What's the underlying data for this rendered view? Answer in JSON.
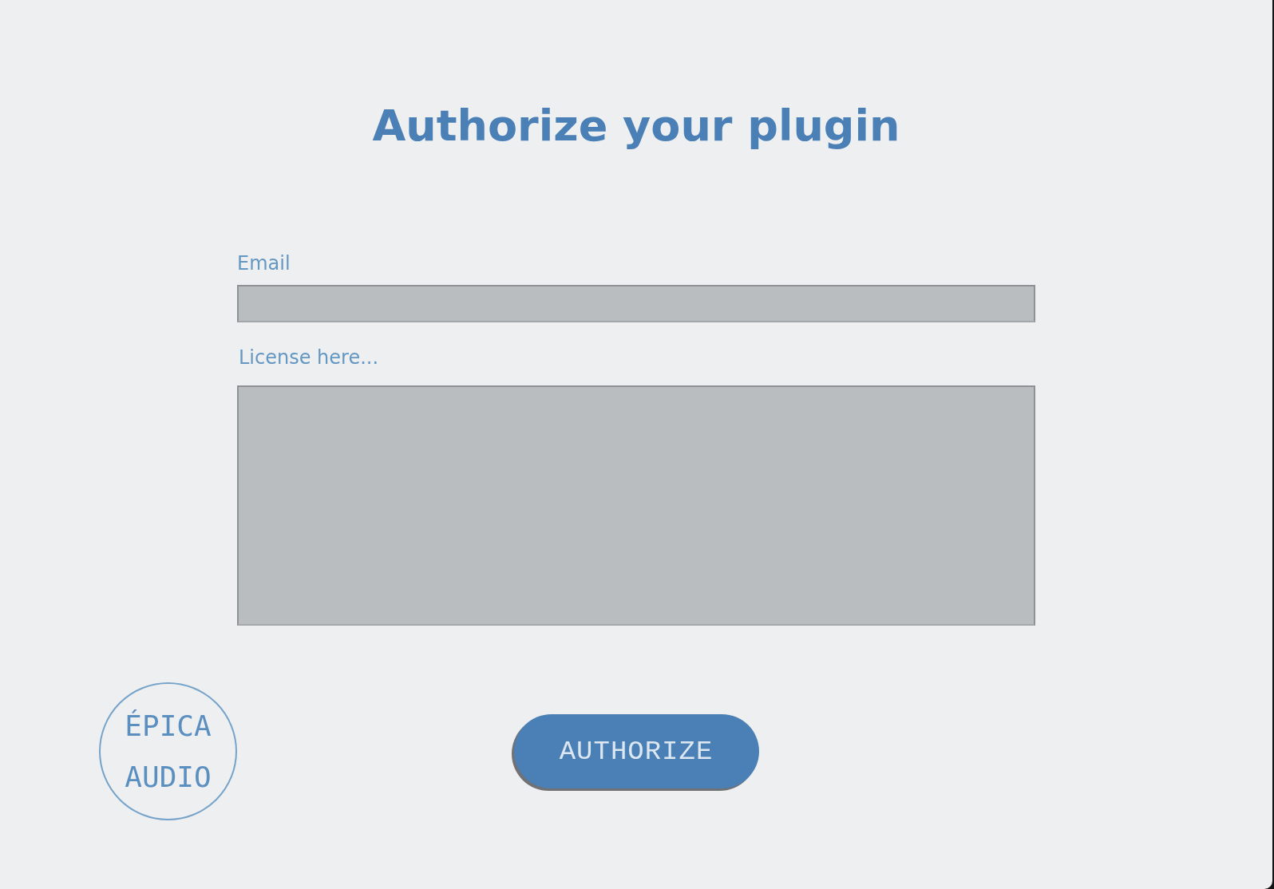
{
  "title": "Authorize your plugin",
  "form": {
    "email": {
      "label": "Email"
    },
    "license": {
      "label": "License here..."
    }
  },
  "logo": {
    "lines": [
      "ÉPICA",
      "AUDIO"
    ]
  },
  "button": {
    "label": "AUTHORIZE"
  }
}
